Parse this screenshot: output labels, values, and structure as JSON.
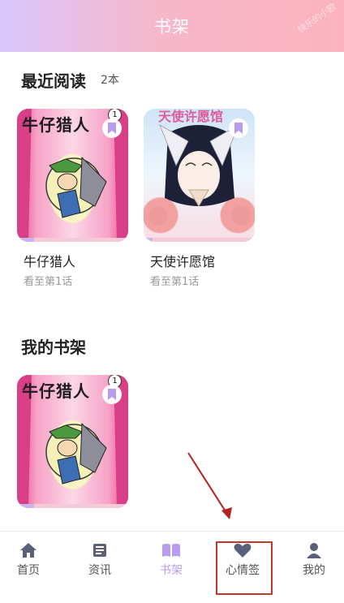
{
  "header": {
    "title": "书架",
    "watermark": "快乐的小欧"
  },
  "recent": {
    "title": "最近阅读",
    "count": "2本",
    "books": [
      {
        "name": "牛仔猎人",
        "progress_text": "看至第1话",
        "cover_title": "牛仔猎人",
        "badge": "1",
        "progress_fraction": 0.15
      },
      {
        "name": "天使许愿馆",
        "progress_text": "看至第1话",
        "cover_title": "天使许愿馆",
        "progress_fraction": 0.08
      }
    ]
  },
  "shelf": {
    "title": "我的书架",
    "books": [
      {
        "cover_title": "牛仔猎人",
        "badge": "1",
        "progress_fraction": 0.15
      }
    ]
  },
  "tabs": [
    {
      "label": "首页",
      "icon": "home-icon"
    },
    {
      "label": "资讯",
      "icon": "news-icon"
    },
    {
      "label": "书架",
      "icon": "book-icon",
      "active": true
    },
    {
      "label": "心情签",
      "icon": "heart-icon"
    },
    {
      "label": "我的",
      "icon": "user-icon"
    }
  ],
  "colors": {
    "accent": "#b79cf0",
    "header_start": "#d9c7fb",
    "header_end": "#fbb4bf",
    "annotation": "#c0392b"
  }
}
